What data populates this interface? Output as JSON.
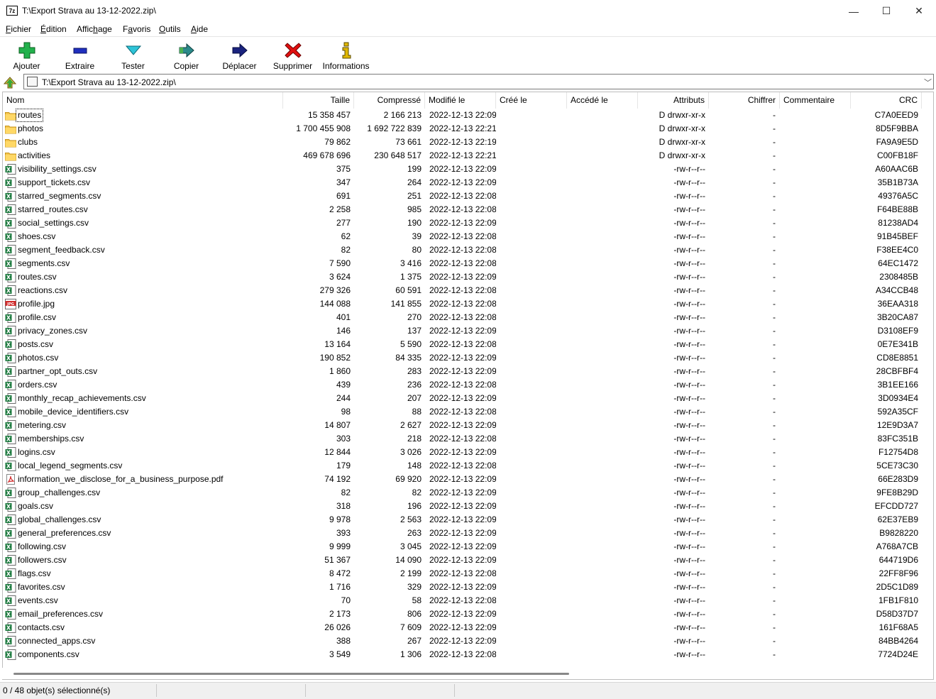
{
  "window": {
    "title": "T:\\Export Strava au 13-12-2022.zip\\",
    "app_icon_text": "7z",
    "minimize_glyph": "—",
    "maximize_glyph": "☐",
    "close_glyph": "✕"
  },
  "menu": [
    {
      "label": "Fichier",
      "accel": "F",
      "rest": "ichier"
    },
    {
      "label": "Édition",
      "accel": "É",
      "rest": "dition"
    },
    {
      "label": "Affichage",
      "pre": "Affic",
      "accel": "h",
      "rest": "age"
    },
    {
      "label": "Favoris",
      "pre": "F",
      "accel": "a",
      "rest": "voris"
    },
    {
      "label": "Outils",
      "accel": "O",
      "rest": "utils"
    },
    {
      "label": "Aide",
      "accel": "A",
      "rest": "ide"
    }
  ],
  "toolbar": {
    "add": "Ajouter",
    "extract": "Extraire",
    "test": "Tester",
    "copy": "Copier",
    "move": "Déplacer",
    "delete": "Supprimer",
    "info": "Informations",
    "colors": {
      "add": "#22b14c",
      "extract": "#1f2fbf",
      "test": "#2ec4d8",
      "copy": "#2b8a8a",
      "move": "#1a237e",
      "delete": "#e01010",
      "info": "#e0b800"
    }
  },
  "address": {
    "path": "T:\\Export Strava au 13-12-2022.zip\\"
  },
  "columns": [
    "Nom",
    "Taille",
    "Compressé",
    "Modifié le",
    "Créé le",
    "Accédé le",
    "Attributs",
    "Chiffrer",
    "Commentaire",
    "CRC"
  ],
  "files": [
    {
      "name": "routes",
      "type": "folder",
      "size": "15 358 457",
      "packed": "2 166 213",
      "modified": "2022-12-13 22:09",
      "attr": "D drwxr-xr-x",
      "enc": "-",
      "crc": "C7A0EED9"
    },
    {
      "name": "photos",
      "type": "folder",
      "size": "1 700 455 908",
      "packed": "1 692 722 839",
      "modified": "2022-12-13 22:21",
      "attr": "D drwxr-xr-x",
      "enc": "-",
      "crc": "8D5F9BBA"
    },
    {
      "name": "clubs",
      "type": "folder",
      "size": "79 862",
      "packed": "73 661",
      "modified": "2022-12-13 22:19",
      "attr": "D drwxr-xr-x",
      "enc": "-",
      "crc": "FA9A9E5D"
    },
    {
      "name": "activities",
      "type": "folder",
      "size": "469 678 696",
      "packed": "230 648 517",
      "modified": "2022-12-13 22:21",
      "attr": "D drwxr-xr-x",
      "enc": "-",
      "crc": "C00FB18F"
    },
    {
      "name": "visibility_settings.csv",
      "type": "csv",
      "size": "375",
      "packed": "199",
      "modified": "2022-12-13 22:09",
      "attr": "-rw-r--r--",
      "enc": "-",
      "crc": "A60AAC6B"
    },
    {
      "name": "support_tickets.csv",
      "type": "csv",
      "size": "347",
      "packed": "264",
      "modified": "2022-12-13 22:09",
      "attr": "-rw-r--r--",
      "enc": "-",
      "crc": "35B1B73A"
    },
    {
      "name": "starred_segments.csv",
      "type": "csv",
      "size": "691",
      "packed": "251",
      "modified": "2022-12-13 22:08",
      "attr": "-rw-r--r--",
      "enc": "-",
      "crc": "49376A5C"
    },
    {
      "name": "starred_routes.csv",
      "type": "csv",
      "size": "2 258",
      "packed": "985",
      "modified": "2022-12-13 22:08",
      "attr": "-rw-r--r--",
      "enc": "-",
      "crc": "F64BE88B"
    },
    {
      "name": "social_settings.csv",
      "type": "csv",
      "size": "277",
      "packed": "190",
      "modified": "2022-12-13 22:09",
      "attr": "-rw-r--r--",
      "enc": "-",
      "crc": "81238AD4"
    },
    {
      "name": "shoes.csv",
      "type": "csv",
      "size": "62",
      "packed": "39",
      "modified": "2022-12-13 22:08",
      "attr": "-rw-r--r--",
      "enc": "-",
      "crc": "91B45BEF"
    },
    {
      "name": "segment_feedback.csv",
      "type": "csv",
      "size": "82",
      "packed": "80",
      "modified": "2022-12-13 22:08",
      "attr": "-rw-r--r--",
      "enc": "-",
      "crc": "F38EE4C0"
    },
    {
      "name": "segments.csv",
      "type": "csv",
      "size": "7 590",
      "packed": "3 416",
      "modified": "2022-12-13 22:08",
      "attr": "-rw-r--r--",
      "enc": "-",
      "crc": "64EC1472"
    },
    {
      "name": "routes.csv",
      "type": "csv",
      "size": "3 624",
      "packed": "1 375",
      "modified": "2022-12-13 22:09",
      "attr": "-rw-r--r--",
      "enc": "-",
      "crc": "2308485B"
    },
    {
      "name": "reactions.csv",
      "type": "csv",
      "size": "279 326",
      "packed": "60 591",
      "modified": "2022-12-13 22:08",
      "attr": "-rw-r--r--",
      "enc": "-",
      "crc": "A34CCB48"
    },
    {
      "name": "profile.jpg",
      "type": "jpg",
      "size": "144 088",
      "packed": "141 855",
      "modified": "2022-12-13 22:08",
      "attr": "-rw-r--r--",
      "enc": "-",
      "crc": "36EAA318"
    },
    {
      "name": "profile.csv",
      "type": "csv",
      "size": "401",
      "packed": "270",
      "modified": "2022-12-13 22:08",
      "attr": "-rw-r--r--",
      "enc": "-",
      "crc": "3B20CA87"
    },
    {
      "name": "privacy_zones.csv",
      "type": "csv",
      "size": "146",
      "packed": "137",
      "modified": "2022-12-13 22:09",
      "attr": "-rw-r--r--",
      "enc": "-",
      "crc": "D3108EF9"
    },
    {
      "name": "posts.csv",
      "type": "csv",
      "size": "13 164",
      "packed": "5 590",
      "modified": "2022-12-13 22:08",
      "attr": "-rw-r--r--",
      "enc": "-",
      "crc": "0E7E341B"
    },
    {
      "name": "photos.csv",
      "type": "csv",
      "size": "190 852",
      "packed": "84 335",
      "modified": "2022-12-13 22:09",
      "attr": "-rw-r--r--",
      "enc": "-",
      "crc": "CD8E8851"
    },
    {
      "name": "partner_opt_outs.csv",
      "type": "csv",
      "size": "1 860",
      "packed": "283",
      "modified": "2022-12-13 22:09",
      "attr": "-rw-r--r--",
      "enc": "-",
      "crc": "28CBFBF4"
    },
    {
      "name": "orders.csv",
      "type": "csv",
      "size": "439",
      "packed": "236",
      "modified": "2022-12-13 22:08",
      "attr": "-rw-r--r--",
      "enc": "-",
      "crc": "3B1EE166"
    },
    {
      "name": "monthly_recap_achievements.csv",
      "type": "csv",
      "size": "244",
      "packed": "207",
      "modified": "2022-12-13 22:09",
      "attr": "-rw-r--r--",
      "enc": "-",
      "crc": "3D0934E4"
    },
    {
      "name": "mobile_device_identifiers.csv",
      "type": "csv",
      "size": "98",
      "packed": "88",
      "modified": "2022-12-13 22:08",
      "attr": "-rw-r--r--",
      "enc": "-",
      "crc": "592A35CF"
    },
    {
      "name": "metering.csv",
      "type": "csv",
      "size": "14 807",
      "packed": "2 627",
      "modified": "2022-12-13 22:09",
      "attr": "-rw-r--r--",
      "enc": "-",
      "crc": "12E9D3A7"
    },
    {
      "name": "memberships.csv",
      "type": "csv",
      "size": "303",
      "packed": "218",
      "modified": "2022-12-13 22:08",
      "attr": "-rw-r--r--",
      "enc": "-",
      "crc": "83FC351B"
    },
    {
      "name": "logins.csv",
      "type": "csv",
      "size": "12 844",
      "packed": "3 026",
      "modified": "2022-12-13 22:09",
      "attr": "-rw-r--r--",
      "enc": "-",
      "crc": "F12754D8"
    },
    {
      "name": "local_legend_segments.csv",
      "type": "csv",
      "size": "179",
      "packed": "148",
      "modified": "2022-12-13 22:08",
      "attr": "-rw-r--r--",
      "enc": "-",
      "crc": "5CE73C30"
    },
    {
      "name": "information_we_disclose_for_a_business_purpose.pdf",
      "type": "pdf",
      "size": "74 192",
      "packed": "69 920",
      "modified": "2022-12-13 22:09",
      "attr": "-rw-r--r--",
      "enc": "-",
      "crc": "66E283D9"
    },
    {
      "name": "group_challenges.csv",
      "type": "csv",
      "size": "82",
      "packed": "82",
      "modified": "2022-12-13 22:09",
      "attr": "-rw-r--r--",
      "enc": "-",
      "crc": "9FE8B29D"
    },
    {
      "name": "goals.csv",
      "type": "csv",
      "size": "318",
      "packed": "196",
      "modified": "2022-12-13 22:09",
      "attr": "-rw-r--r--",
      "enc": "-",
      "crc": "EFCDD727"
    },
    {
      "name": "global_challenges.csv",
      "type": "csv",
      "size": "9 978",
      "packed": "2 563",
      "modified": "2022-12-13 22:09",
      "attr": "-rw-r--r--",
      "enc": "-",
      "crc": "62E37EB9"
    },
    {
      "name": "general_preferences.csv",
      "type": "csv",
      "size": "393",
      "packed": "263",
      "modified": "2022-12-13 22:09",
      "attr": "-rw-r--r--",
      "enc": "-",
      "crc": "B9828220"
    },
    {
      "name": "following.csv",
      "type": "csv",
      "size": "9 999",
      "packed": "3 045",
      "modified": "2022-12-13 22:09",
      "attr": "-rw-r--r--",
      "enc": "-",
      "crc": "A768A7CB"
    },
    {
      "name": "followers.csv",
      "type": "csv",
      "size": "51 367",
      "packed": "14 090",
      "modified": "2022-12-13 22:09",
      "attr": "-rw-r--r--",
      "enc": "-",
      "crc": "644719D6"
    },
    {
      "name": "flags.csv",
      "type": "csv",
      "size": "8 472",
      "packed": "2 199",
      "modified": "2022-12-13 22:08",
      "attr": "-rw-r--r--",
      "enc": "-",
      "crc": "22FF8F96"
    },
    {
      "name": "favorites.csv",
      "type": "csv",
      "size": "1 716",
      "packed": "329",
      "modified": "2022-12-13 22:09",
      "attr": "-rw-r--r--",
      "enc": "-",
      "crc": "2D5C1D89"
    },
    {
      "name": "events.csv",
      "type": "csv",
      "size": "70",
      "packed": "58",
      "modified": "2022-12-13 22:08",
      "attr": "-rw-r--r--",
      "enc": "-",
      "crc": "1FB1F810"
    },
    {
      "name": "email_preferences.csv",
      "type": "csv",
      "size": "2 173",
      "packed": "806",
      "modified": "2022-12-13 22:09",
      "attr": "-rw-r--r--",
      "enc": "-",
      "crc": "D58D37D7"
    },
    {
      "name": "contacts.csv",
      "type": "csv",
      "size": "26 026",
      "packed": "7 609",
      "modified": "2022-12-13 22:09",
      "attr": "-rw-r--r--",
      "enc": "-",
      "crc": "161F68A5"
    },
    {
      "name": "connected_apps.csv",
      "type": "csv",
      "size": "388",
      "packed": "267",
      "modified": "2022-12-13 22:09",
      "attr": "-rw-r--r--",
      "enc": "-",
      "crc": "84BB4264"
    },
    {
      "name": "components.csv",
      "type": "csv",
      "size": "3 549",
      "packed": "1 306",
      "modified": "2022-12-13 22:08",
      "attr": "-rw-r--r--",
      "enc": "-",
      "crc": "7724D24E"
    }
  ],
  "status": {
    "selection": "0 / 48 objet(s) sélectionné(s)"
  }
}
